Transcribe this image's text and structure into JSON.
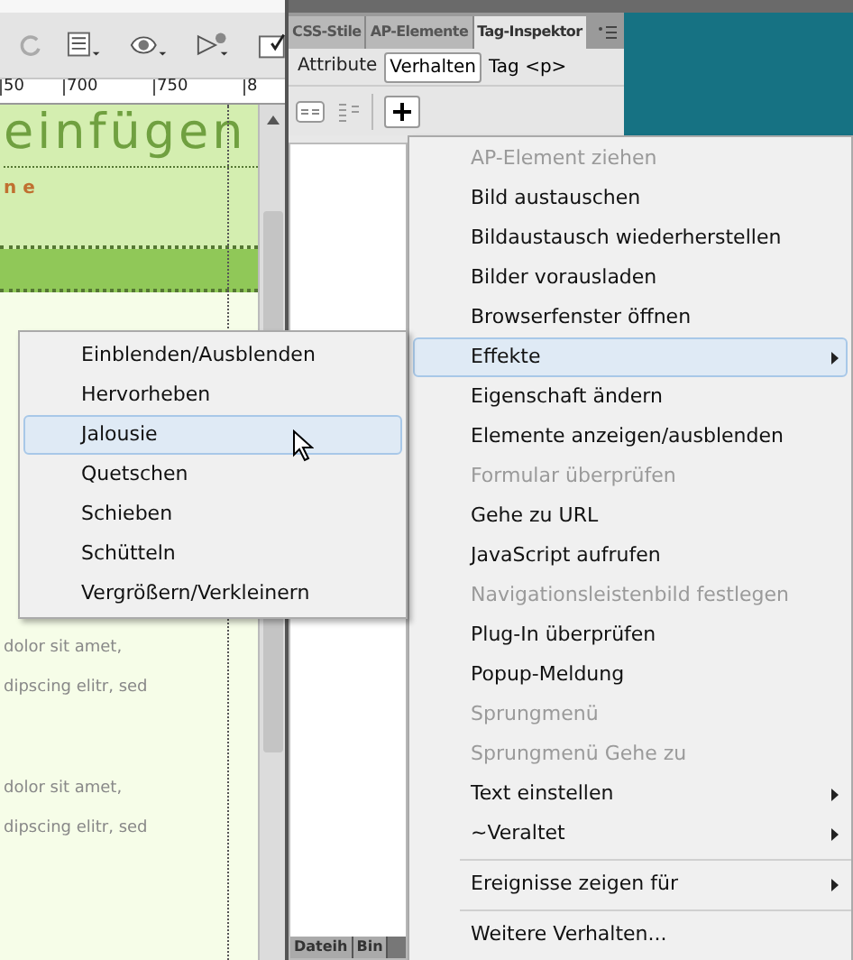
{
  "ruler": {
    "labels": [
      "50",
      "700",
      "750",
      "8"
    ]
  },
  "document": {
    "heading": "einfügen",
    "subheading": "n e",
    "paragraphs": [
      "dolor sit amet,",
      "dipscing elitr, sed",
      "dolor sit amet,",
      "dipscing elitr, sed"
    ]
  },
  "panel": {
    "tabs": [
      {
        "label": "CSS-Stile",
        "selected": false
      },
      {
        "label": "AP-Elemente",
        "selected": false
      },
      {
        "label": "Tag-Inspektor",
        "selected": true
      }
    ],
    "subtabs": [
      {
        "label": "Attribute",
        "selected": false
      },
      {
        "label": "Verhalten",
        "selected": true
      }
    ],
    "tag_label": "Tag <p>"
  },
  "bottom_tabs": [
    {
      "label": "Dateih",
      "selected": false
    },
    {
      "label": "Bin",
      "selected": false
    }
  ],
  "menu": [
    {
      "kind": "item",
      "label": "AP-Element ziehen",
      "disabled": true,
      "submenu": false,
      "selected": false
    },
    {
      "kind": "item",
      "label": "Bild austauschen",
      "disabled": false,
      "submenu": false,
      "selected": false
    },
    {
      "kind": "item",
      "label": "Bildaustausch wiederherstellen",
      "disabled": false,
      "submenu": false,
      "selected": false
    },
    {
      "kind": "item",
      "label": "Bilder vorausladen",
      "disabled": false,
      "submenu": false,
      "selected": false
    },
    {
      "kind": "item",
      "label": "Browserfenster öffnen",
      "disabled": false,
      "submenu": false,
      "selected": false
    },
    {
      "kind": "item",
      "label": "Effekte",
      "disabled": false,
      "submenu": true,
      "selected": true
    },
    {
      "kind": "item",
      "label": "Eigenschaft ändern",
      "disabled": false,
      "submenu": false,
      "selected": false
    },
    {
      "kind": "item",
      "label": "Elemente anzeigen/ausblenden",
      "disabled": false,
      "submenu": false,
      "selected": false
    },
    {
      "kind": "item",
      "label": "Formular überprüfen",
      "disabled": true,
      "submenu": false,
      "selected": false
    },
    {
      "kind": "item",
      "label": "Gehe zu URL",
      "disabled": false,
      "submenu": false,
      "selected": false
    },
    {
      "kind": "item",
      "label": "JavaScript aufrufen",
      "disabled": false,
      "submenu": false,
      "selected": false
    },
    {
      "kind": "item",
      "label": "Navigationsleistenbild festlegen",
      "disabled": true,
      "submenu": false,
      "selected": false
    },
    {
      "kind": "item",
      "label": "Plug-In überprüfen",
      "disabled": false,
      "submenu": false,
      "selected": false
    },
    {
      "kind": "item",
      "label": "Popup-Meldung",
      "disabled": false,
      "submenu": false,
      "selected": false
    },
    {
      "kind": "item",
      "label": "Sprungmenü",
      "disabled": true,
      "submenu": false,
      "selected": false
    },
    {
      "kind": "item",
      "label": "Sprungmenü Gehe zu",
      "disabled": true,
      "submenu": false,
      "selected": false
    },
    {
      "kind": "item",
      "label": "Text einstellen",
      "disabled": false,
      "submenu": true,
      "selected": false
    },
    {
      "kind": "item",
      "label": "~Veraltet",
      "disabled": false,
      "submenu": true,
      "selected": false
    },
    {
      "kind": "separator"
    },
    {
      "kind": "item",
      "label": "Ereignisse zeigen für",
      "disabled": false,
      "submenu": true,
      "selected": false
    },
    {
      "kind": "separator"
    },
    {
      "kind": "item",
      "label": "Weitere Verhalten...",
      "disabled": false,
      "submenu": false,
      "selected": false
    }
  ],
  "submenu": [
    {
      "label": "Einblenden/Ausblenden",
      "selected": false
    },
    {
      "label": "Hervorheben",
      "selected": false
    },
    {
      "label": "Jalousie",
      "selected": true
    },
    {
      "label": "Quetschen",
      "selected": false
    },
    {
      "label": "Schieben",
      "selected": false
    },
    {
      "label": "Schütteln",
      "selected": false
    },
    {
      "label": "Vergrößern/Verkleinern",
      "selected": false
    }
  ]
}
